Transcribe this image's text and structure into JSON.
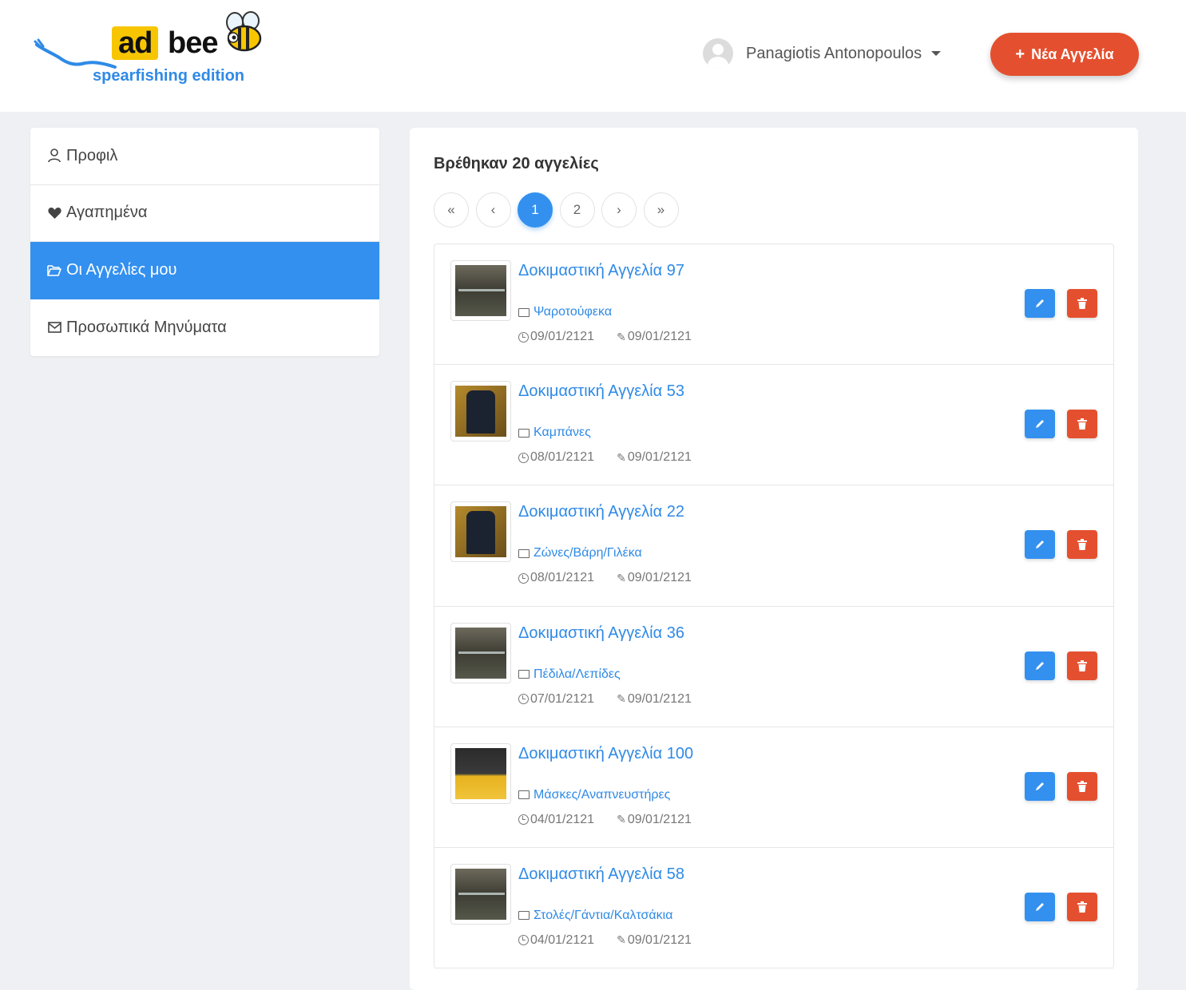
{
  "header": {
    "logo": {
      "ad": "ad",
      "bee": "bee",
      "edition": "spearfishing edition"
    },
    "user_name": "Panagiotis Antonopoulos",
    "new_ad_label": "Νέα Αγγελία",
    "new_ad_icon": "+"
  },
  "sidebar": {
    "items": [
      {
        "label": "Προφιλ",
        "icon": "user-icon",
        "active": false
      },
      {
        "label": "Αγαπημένα",
        "icon": "heart-icon",
        "active": false
      },
      {
        "label": "Οι Αγγελίες μου",
        "icon": "folder-open-icon",
        "active": true
      },
      {
        "label": "Προσωπικά Μηνύματα",
        "icon": "envelope-icon",
        "active": false
      }
    ]
  },
  "main": {
    "found_text": "Βρέθηκαν 20 αγγελίες",
    "pagination": {
      "first": "«",
      "prev": "‹",
      "pages": [
        "1",
        "2"
      ],
      "current": "1",
      "next": "›",
      "last": "»"
    },
    "listings": [
      {
        "title": "Δοκιμαστική Αγγελία 97",
        "category": "Ψαροτούφεκα",
        "created": "09/01/2121",
        "updated": "09/01/2121",
        "image": "gun"
      },
      {
        "title": "Δοκιμαστική Αγγελία 53",
        "category": "Καμπάνες",
        "created": "08/01/2121",
        "updated": "09/01/2121",
        "image": "suit"
      },
      {
        "title": "Δοκιμαστική Αγγελία 22",
        "category": "Ζώνες/Βάρη/Γιλέκα",
        "created": "08/01/2121",
        "updated": "09/01/2121",
        "image": "suit"
      },
      {
        "title": "Δοκιμαστική Αγγελία 36",
        "category": "Πέδιλα/Λεπίδες",
        "created": "07/01/2121",
        "updated": "09/01/2121",
        "image": "gun"
      },
      {
        "title": "Δοκιμαστική Αγγελία 100",
        "category": "Μάσκες/Αναπνευστήρες",
        "created": "04/01/2121",
        "updated": "09/01/2121",
        "image": "mask"
      },
      {
        "title": "Δοκιμαστική Αγγελία 58",
        "category": "Στολές/Γάντια/Καλτσάκια",
        "created": "04/01/2121",
        "updated": "09/01/2121",
        "image": "gun"
      }
    ]
  },
  "colors": {
    "primary": "#3390ef",
    "danger": "#e4502f",
    "brand_yellow": "#f7c600",
    "link": "#2f8ae6"
  }
}
